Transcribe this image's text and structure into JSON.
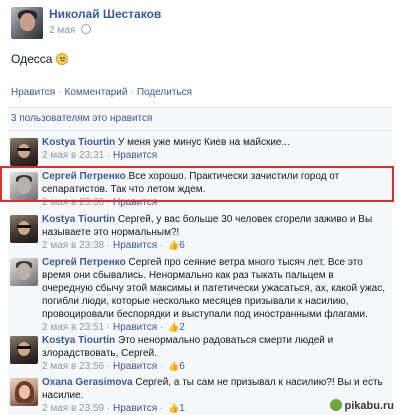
{
  "post": {
    "author": "Николай Шестаков",
    "date": "2 мая",
    "text": "Одесса",
    "actions": {
      "like": "Нравится",
      "comment": "Комментарий",
      "share": "Поделиться"
    },
    "likes_summary": "3 пользователям это нравится"
  },
  "comments": [
    {
      "author": "Kostya Tiourtin",
      "text": "У меня уже минус Киев на майские...",
      "time": "2 мая в 23:31",
      "like_label": "Нравится",
      "likes": ""
    },
    {
      "author": "Сергей Петренко",
      "text": "Все хорошо. Практически зачистили город от сепаратистов. Так что летом ждем.",
      "time": "2 мая в 23:36",
      "like_label": "Нравится",
      "likes": ""
    },
    {
      "author": "Kostya Tiourtin",
      "text": "Сергей, у вас больше 30 человек сгорели заживо и Вы называете это нормальным?!",
      "time": "2 мая в 23:38",
      "like_label": "Нравится",
      "likes": "6"
    },
    {
      "author": "Сергей Петренко",
      "text": "Сергей про сеяние ветра много тысяч лет. Все это время они сбывались. Ненормально как раз тыкать пальцем в очередную сбычу этой максимы и патетически ужасаться, ах, какой ужас, погибли люди, которые несколько месяцев призывали к насилию, провоцировали беспорядки и выступали под иностранными флагами.",
      "time": "2 мая в 23:51",
      "like_label": "Нравится",
      "likes": "2"
    },
    {
      "author": "Kostya Tiourtin",
      "text": "Это ненормально радоваться смерти людей и злорадствовать, Сергей.",
      "time": "2 мая в 23:56",
      "like_label": "Нравится",
      "likes": "6"
    },
    {
      "author": "Oxana Gerasimova",
      "text": "Сергей, а ты сам не призывал к насилию?! Вы и есть насилие.",
      "time": "2 мая в 23:59",
      "like_label": "Нравится",
      "likes": "1"
    }
  ],
  "watermark": "pikabu.ru",
  "icons": {
    "globe": "globe-icon",
    "emoji": "smile-emoji-icon",
    "thumb": "thumbs-up-icon"
  },
  "colors": {
    "link": "#3b5998",
    "meta": "#9197a3",
    "comments_bg": "#f6f7f8",
    "highlight": "#d9302c"
  }
}
